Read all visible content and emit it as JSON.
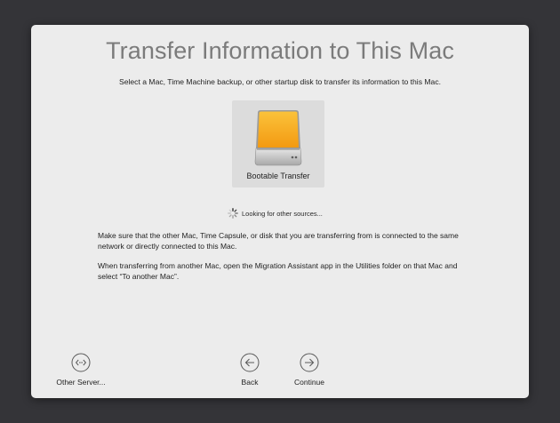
{
  "window": {
    "title": "Transfer Information to This Mac",
    "subtitle": "Select a Mac, Time Machine backup, or other startup disk to transfer its information to this Mac."
  },
  "sources": [
    {
      "label": "Bootable Transfer",
      "icon": "external-drive-icon"
    }
  ],
  "status": {
    "text": "Looking for other sources...",
    "icon": "spinner-icon"
  },
  "info": {
    "paragraph1": "Make sure that the other Mac, Time Capsule, or disk that you are transferring from is connected to the same network or directly connected to this Mac.",
    "paragraph2": "When transferring from another Mac, open the Migration Assistant app in the Utilities folder on that Mac and select “To another Mac”."
  },
  "buttons": {
    "other_server": {
      "label": "Other Server...",
      "icon": "code-brackets-icon"
    },
    "back": {
      "label": "Back",
      "icon": "arrow-left-circle-icon"
    },
    "continue": {
      "label": "Continue",
      "icon": "arrow-right-circle-icon"
    }
  },
  "colors": {
    "desktop_background": "#343438",
    "panel_background": "#ececec",
    "title_text": "#7b7b7b",
    "drive_orange": "#f7a81e"
  }
}
